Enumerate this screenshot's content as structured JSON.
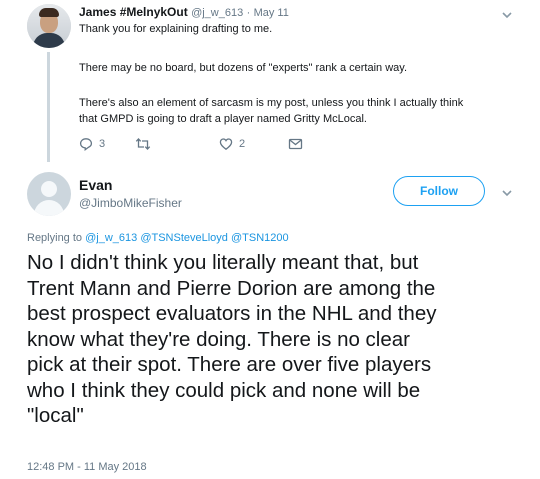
{
  "parent_tweet": {
    "name": "James #MelnykOut",
    "handle": "@j_w_613",
    "separator": "·",
    "date": "May 11",
    "lines": [
      "Thank you for explaining drafting to me.",
      "There may be no board, but dozens of \"experts\" rank a certain way.",
      "There's also an element of sarcasm is my post, unless you think I actually think",
      "that GMPD is going to draft a player named Gritty McLocal."
    ],
    "actions": {
      "reply_count": "3",
      "retweet_count": "",
      "like_count": "2"
    },
    "icons": [
      "reply-icon",
      "retweet-icon",
      "like-icon",
      "direct-message-icon",
      "chevron-down-icon"
    ]
  },
  "main_tweet": {
    "name": "Evan",
    "handle": "@JimboMikeFisher",
    "follow_label": "Follow",
    "replying_prefix": "Replying to",
    "replying_mentions": [
      "@j_w_613",
      "@TSNSteveLloyd",
      "@TSN1200"
    ],
    "text_lines": [
      "No I didn't think you literally meant that, but",
      "Trent Mann and Pierre Dorion are among the",
      "best prospect evaluators in the NHL  and they",
      "know what they're doing. There is no clear",
      "pick at their spot. There are over five players",
      "who I think they could pick and none will be",
      "\"local\""
    ],
    "timestamp": "12:48 PM - 11 May 2018"
  },
  "colors": {
    "link": "#1b95e0",
    "follow_accent": "#1da1f2",
    "secondary_text": "#657786",
    "primary_text": "#14171a",
    "thread_line": "#ccd6dd"
  }
}
